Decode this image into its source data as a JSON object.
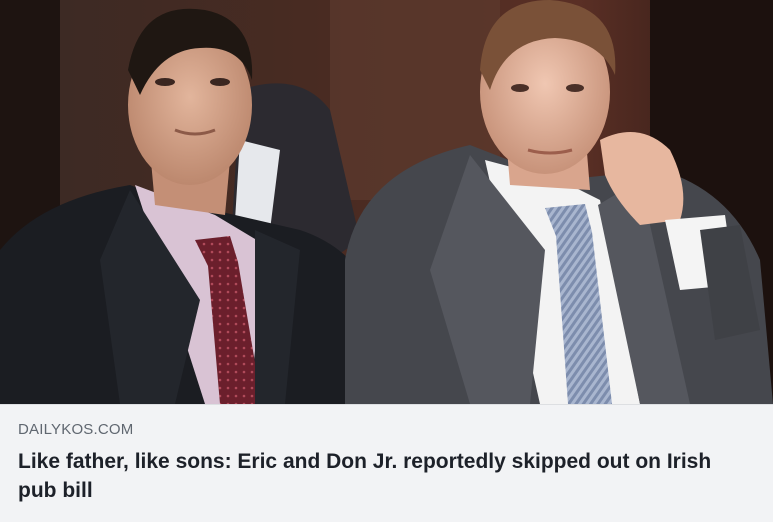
{
  "link_card": {
    "domain": "DAILYKOS.COM",
    "headline": "Like father, like sons: Eric and Don Jr. reportedly skipped out on Irish pub bill",
    "photo": {
      "subject": "photo-two-men-in-suits"
    }
  },
  "colors": {
    "caption_background": "#f2f3f5",
    "domain_text": "#606770",
    "headline_text": "#1d2129"
  }
}
